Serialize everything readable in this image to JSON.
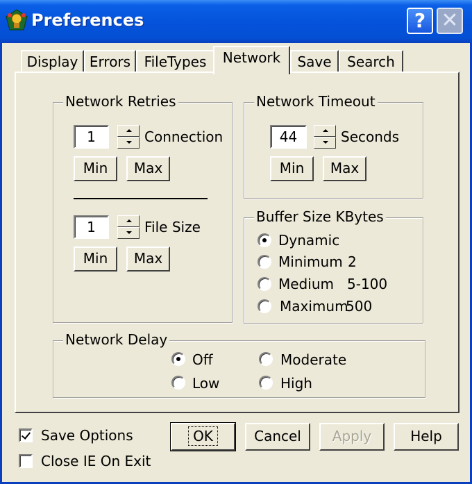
{
  "window": {
    "title": "Preferences",
    "help_glyph": "?",
    "close_glyph": "✕"
  },
  "tabs": [
    {
      "label": "Display",
      "active": false
    },
    {
      "label": "Errors",
      "active": false
    },
    {
      "label": "FileTypes",
      "active": false
    },
    {
      "label": "Network",
      "active": true
    },
    {
      "label": "Save",
      "active": false
    },
    {
      "label": "Search",
      "active": false
    }
  ],
  "network_retries": {
    "legend": "Network Retries",
    "connection": {
      "value": "1",
      "label": "Connection",
      "min_label": "Min",
      "max_label": "Max"
    },
    "file_size": {
      "value": "1",
      "label": "File Size",
      "min_label": "Min",
      "max_label": "Max"
    }
  },
  "network_timeout": {
    "legend": "Network Timeout",
    "value": "44",
    "label": "Seconds",
    "min_label": "Min",
    "max_label": "Max"
  },
  "buffer_size": {
    "legend": "Buffer Size KBytes",
    "selected": "Dynamic",
    "options": [
      {
        "label": "Dynamic",
        "value": ""
      },
      {
        "label": "Minimum",
        "value": "2"
      },
      {
        "label": "Medium",
        "value": "5-100"
      },
      {
        "label": "Maximum",
        "value": "500"
      }
    ]
  },
  "network_delay": {
    "legend": "Network Delay",
    "selected": "Off",
    "options": [
      "Off",
      "Moderate",
      "Low",
      "High"
    ]
  },
  "footer": {
    "save_options": {
      "label": "Save Options",
      "checked": true
    },
    "close_ie": {
      "label": "Close IE On Exit",
      "checked": false
    },
    "ok_label": "OK",
    "cancel_label": "Cancel",
    "apply_label": "Apply",
    "apply_enabled": false,
    "help_label": "Help"
  },
  "colors": {
    "title_bar": "#0553db",
    "face": "#ece9d8"
  },
  "icons": {
    "app": "trophy-app-icon",
    "help": "question-mark-icon",
    "close": "close-icon"
  }
}
